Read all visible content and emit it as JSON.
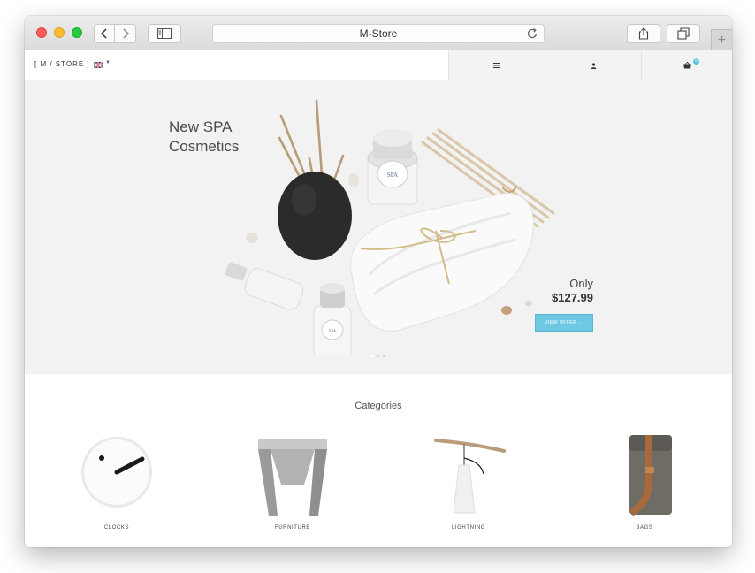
{
  "browser": {
    "url_title": "M-Store"
  },
  "site": {
    "logo": "[ M / STORE ]",
    "cart_count": "0"
  },
  "hero": {
    "title": "New SPA\nCosmetics",
    "price_label": "Only",
    "price": "$127.99",
    "cta_label": "VIEW OFFER →",
    "slide_count": 3,
    "active_slide": 1
  },
  "categories": {
    "heading": "Categories",
    "items": [
      {
        "label": "CLOCKS"
      },
      {
        "label": "FURNITURE"
      },
      {
        "label": "LIGHTNING"
      },
      {
        "label": "BAGS"
      }
    ]
  },
  "colors": {
    "accent": "#6fc8e3",
    "hero_bg": "#f2f2f2"
  }
}
